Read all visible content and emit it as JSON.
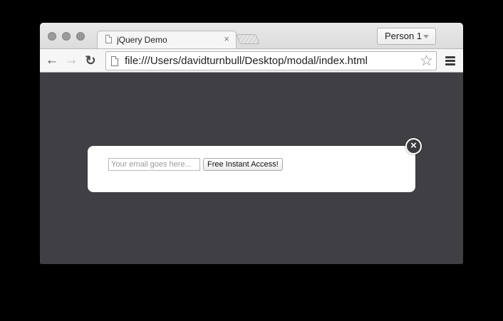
{
  "browser": {
    "tab": {
      "title": "jQuery Demo",
      "close_glyph": "×"
    },
    "profile": {
      "label": "Person 1"
    },
    "toolbar": {
      "back_glyph": "←",
      "forward_glyph": "→",
      "reload_glyph": "↻",
      "url": "file:///Users/davidturnbull/Desktop/modal/index.html",
      "bookmark_glyph": "☆"
    }
  },
  "page": {
    "background_color": "#403f43",
    "modal": {
      "email_placeholder": "Your email goes here...",
      "email_value": "",
      "submit_label": "Free Instant Access!",
      "close_glyph": "×"
    }
  }
}
